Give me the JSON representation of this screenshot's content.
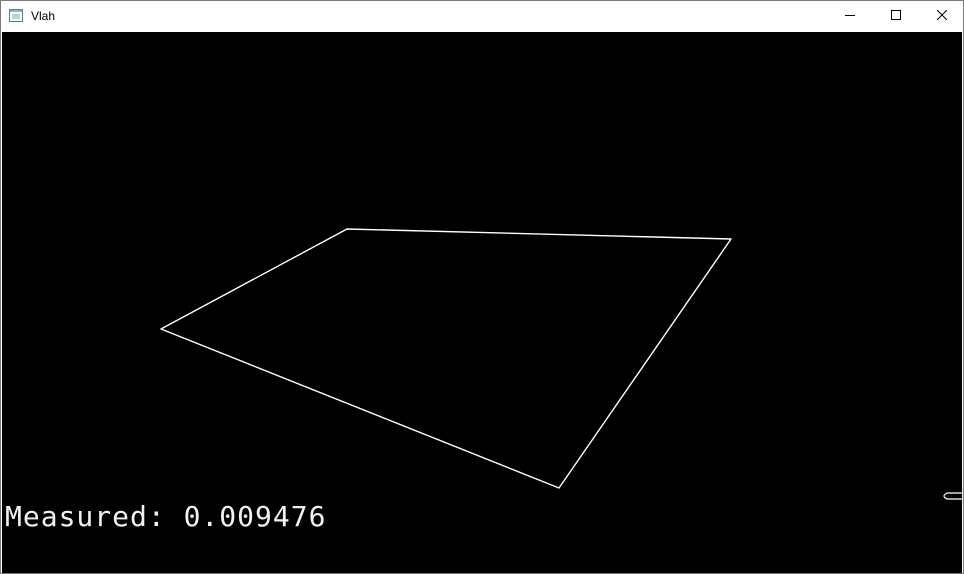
{
  "window": {
    "title": "Vlah",
    "background": "#000000",
    "controls": {
      "minimize_icon": "minimize-icon",
      "maximize_icon": "maximize-icon",
      "close_icon": "close-icon"
    }
  },
  "canvas": {
    "shape": "quadrilateral-outline",
    "stroke_color": "#ffffff",
    "measured_text": "Measured: 0.009476"
  }
}
